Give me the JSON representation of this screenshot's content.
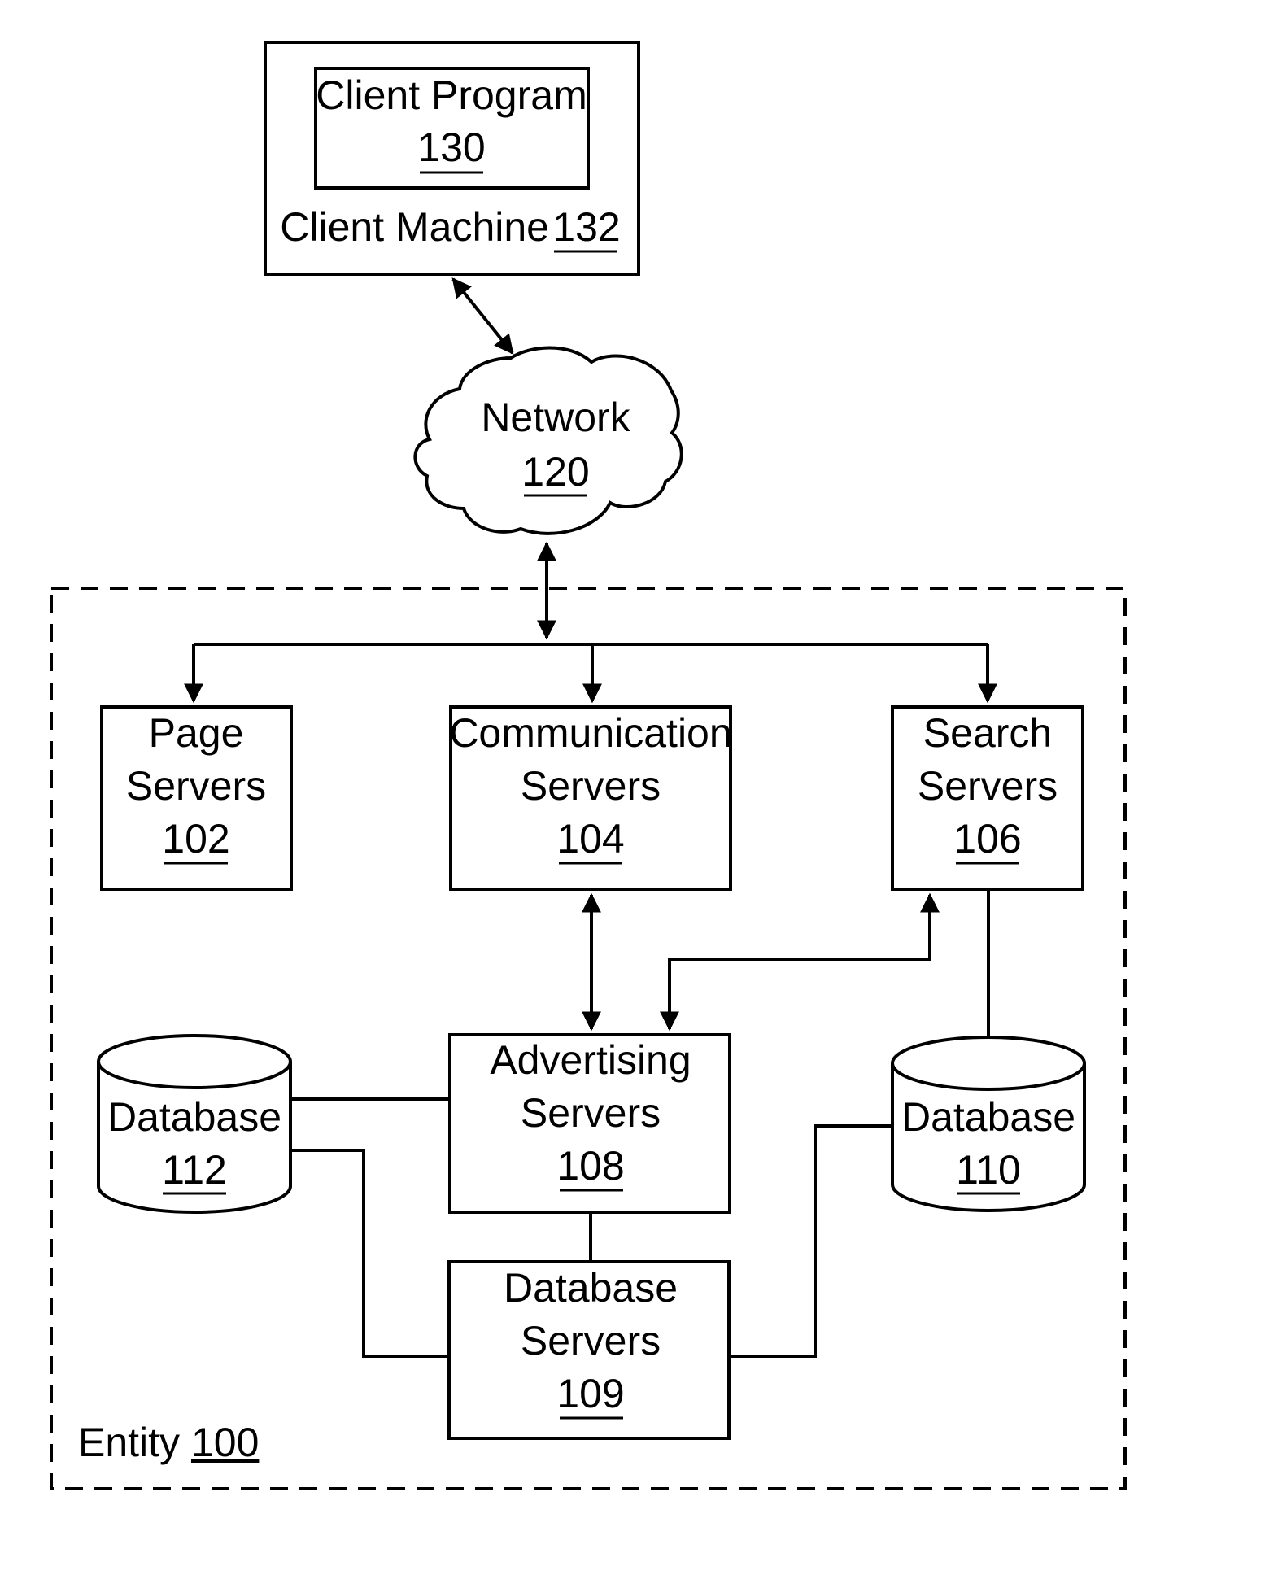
{
  "diagram": {
    "entity": {
      "label": "Entity",
      "ref": "100"
    },
    "client_machine": {
      "label": "Client Machine",
      "ref": "132"
    },
    "client_program": {
      "label": "Client Program",
      "ref": "130"
    },
    "network": {
      "label": "Network",
      "ref": "120"
    },
    "page_servers": {
      "line1": "Page",
      "line2": "Servers",
      "ref": "102"
    },
    "communication_servers": {
      "line1": "Communication",
      "line2": "Servers",
      "ref": "104"
    },
    "search_servers": {
      "line1": "Search",
      "line2": "Servers",
      "ref": "106"
    },
    "advertising_servers": {
      "line1": "Advertising",
      "line2": "Servers",
      "ref": "108"
    },
    "database_servers": {
      "line1": "Database",
      "line2": "Servers",
      "ref": "109"
    },
    "database_112": {
      "label": "Database",
      "ref": "112"
    },
    "database_110": {
      "label": "Database",
      "ref": "110"
    }
  }
}
